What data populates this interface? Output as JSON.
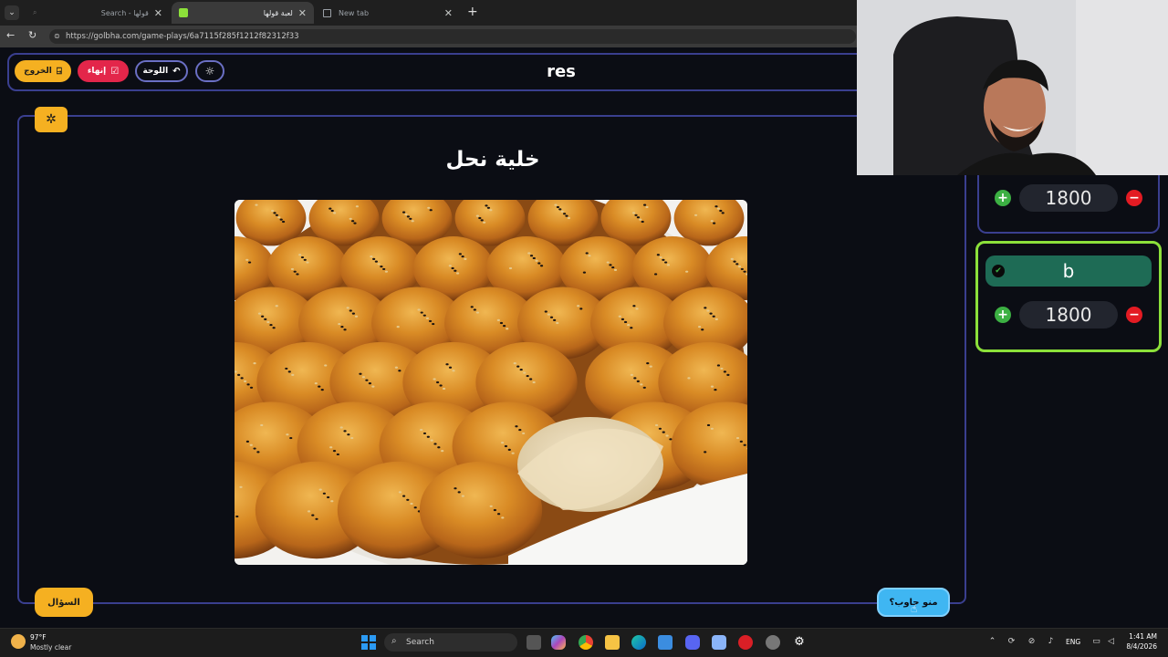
{
  "browser": {
    "tabs": [
      {
        "label": "Search - قولها",
        "active": false
      },
      {
        "label": "لعبة قولها",
        "active": true
      },
      {
        "label": "New tab",
        "active": false
      }
    ],
    "url": "https://golbha.com/game-plays/6a7115f285f1212f82312f33"
  },
  "header": {
    "exit_label": "الخروج",
    "end_label": "إنهاء",
    "board_label": "اللوحة",
    "title": "res"
  },
  "question": {
    "title": "خلية نحل",
    "question_button": "السؤال",
    "who_answered_button": "منو جاوب؟"
  },
  "teams": [
    {
      "name": "",
      "score": "1800",
      "answered": false
    },
    {
      "name": "b",
      "score": "1800",
      "answered": true
    }
  ],
  "taskbar": {
    "weather_temp": "97°F",
    "weather_desc": "Mostly clear",
    "search_label": "Search",
    "language": "ENG",
    "time": "1:41 AM",
    "date": "8/4/2026"
  },
  "colors": {
    "accent_yellow": "#f5b021",
    "end_red": "#e3264a",
    "frame_blue": "#3a3f8f",
    "active_team_green": "#8ce03a",
    "who_blue": "#3fb6f2"
  }
}
